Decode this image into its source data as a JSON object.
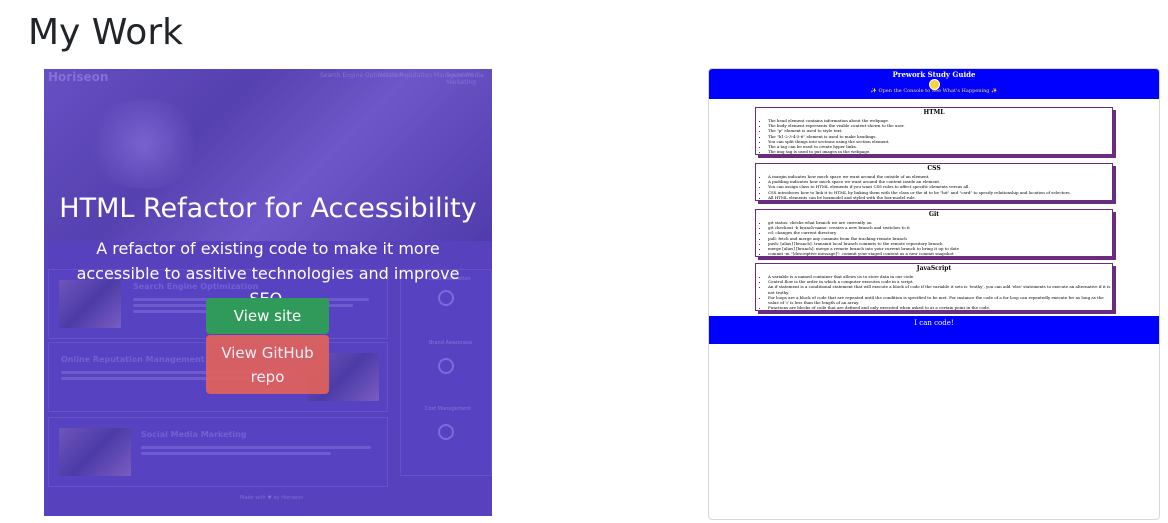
{
  "page": {
    "title": "My Work"
  },
  "project1": {
    "title": "HTML Refactor for Accessibility",
    "description": "A refactor of existing code to make it more accessible to assitive technologies and improve SEO.",
    "view_site_label": "View site",
    "repo_label": "View GitHub repo",
    "preview": {
      "brand": "Horiseon",
      "nav": [
        "Search Engine Optimization",
        "Online Reputation Management",
        "Social Media Marketing"
      ],
      "sections": [
        "Search Engine Optimization",
        "Online Reputation Management",
        "Social Media Marketing"
      ],
      "sidebar": [
        "Lead Generation",
        "Brand Awareness",
        "Cost Management"
      ],
      "footer": "Made with ♥ by Horiseon"
    },
    "colors": {
      "overlay": "#543ec8",
      "view_button": "#2f9a5a",
      "repo_button": "#e0625a"
    }
  },
  "project2": {
    "title": "Prework Study Guide",
    "subtitle": "✨ Open the Console to See What's Happening ✨",
    "footer": "I can code!",
    "sections": [
      {
        "title": "HTML",
        "items": [
          "The head element contains information about the webpage.",
          "The body element represents the visible content shown to the user.",
          "The \"p\" element is used to style text.",
          "The \"h1-2-3-4-5-6\" element is used to make headings.",
          "You can split things into sections using the section element.",
          "The a tag can be used to create hyper links.",
          "The img tag is used to put images in the webpage."
        ]
      },
      {
        "title": "CSS",
        "items": [
          "A margin indicates how much space we want around the outside of an element.",
          "A padding indicates how much space we want around the content inside an element.",
          "You can assign class to HTML elements if you want CSS rules to affect specific elements versus all.",
          "CSS introduces how to link it to HTML by linking them with the class or the id to be \"hit\" and \"card\" to specify relationship and location of selectors.",
          "All HTML elements can be boxmodel and styled with the box-model rule."
        ]
      },
      {
        "title": "Git",
        "items": [
          "git status: checks what branch we are currently on",
          "git checkout -b branch-name: creates a new branch and switches to it",
          "cd: changes the current directory",
          "pull: fetch and merge any commits from the tracking remote branch",
          "push: [alias] [branch]: transmit local branch commits to the remote repository branch",
          "merge [alias] [branch]: merge a remote branch into your current branch to bring it up to date",
          "commit -m \"[descriptive message]\": commit your staged content as a new commit snapshot"
        ]
      },
      {
        "title": "JavaScript",
        "items": [
          "A variable is a named container that allows us to store data in our code.",
          "Control flow is the order in which a computer executes code in a script.",
          "An if statement is a conditional statement that will execute a block of code if the variable it sets is 'truthy', you can add 'else' statements to execute an alternative if it is not truthy.",
          "For loops are a block of code that are repeated until the condition is specified to be met. For instance the code of a for loop can repeatedly execute for as long as the value of 'i' is less than the length of an array.",
          "Functions are blocks of code that are defined and only executed when asked to at a certain point in the code."
        ]
      }
    ],
    "colors": {
      "header": "#0000ff",
      "section_border": "#6b2b7e",
      "subtitle": "#ffdd55"
    }
  }
}
